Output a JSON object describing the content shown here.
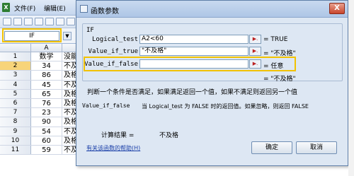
{
  "excel": {
    "logo": "X",
    "menu": [
      "文件(F)",
      "编辑(E)"
    ],
    "namebox": "IF",
    "namebox_arrow": "▼",
    "columns": [
      "A",
      ""
    ],
    "rows": [
      {
        "n": "1",
        "a": "数学",
        "b": "没能"
      },
      {
        "n": "2",
        "a": "34",
        "b": "不及"
      },
      {
        "n": "3",
        "a": "86",
        "b": "及格"
      },
      {
        "n": "4",
        "a": "45",
        "b": "不及"
      },
      {
        "n": "5",
        "a": "65",
        "b": "及格"
      },
      {
        "n": "6",
        "a": "76",
        "b": "及格"
      },
      {
        "n": "7",
        "a": "23",
        "b": "不及"
      },
      {
        "n": "8",
        "a": "90",
        "b": "及格"
      },
      {
        "n": "9",
        "a": "54",
        "b": "不及"
      },
      {
        "n": "10",
        "a": "60",
        "b": "及格"
      },
      {
        "n": "11",
        "a": "59",
        "b": "不及格"
      }
    ]
  },
  "dialog": {
    "title": "函数参数",
    "close": "X",
    "function_name": "IF",
    "args": [
      {
        "label": "Logical_test",
        "value": "A2<60",
        "result": "= TRUE"
      },
      {
        "label": "Value_if_true",
        "value": "\"不及格\"",
        "result": "= \"不及格\""
      },
      {
        "label": "Value_if_false",
        "value": "",
        "result": "= 任意"
      }
    ],
    "arg_button": "▶.",
    "function_result": "= \"不及格\"",
    "description": "判断一个条件是否满足，如果满足返回一个值，如果不满足则返回另一个值",
    "arg_desc_name": "Value_if_false",
    "arg_desc_text": "当 Logical_test 为 FALSE 时的返回值。如果忽略，则返回 FALSE",
    "calc_label": "计算结果 =",
    "calc_value": "不及格",
    "help_link": "有关该函数的帮助(H)",
    "ok": "确定",
    "cancel": "取消"
  }
}
